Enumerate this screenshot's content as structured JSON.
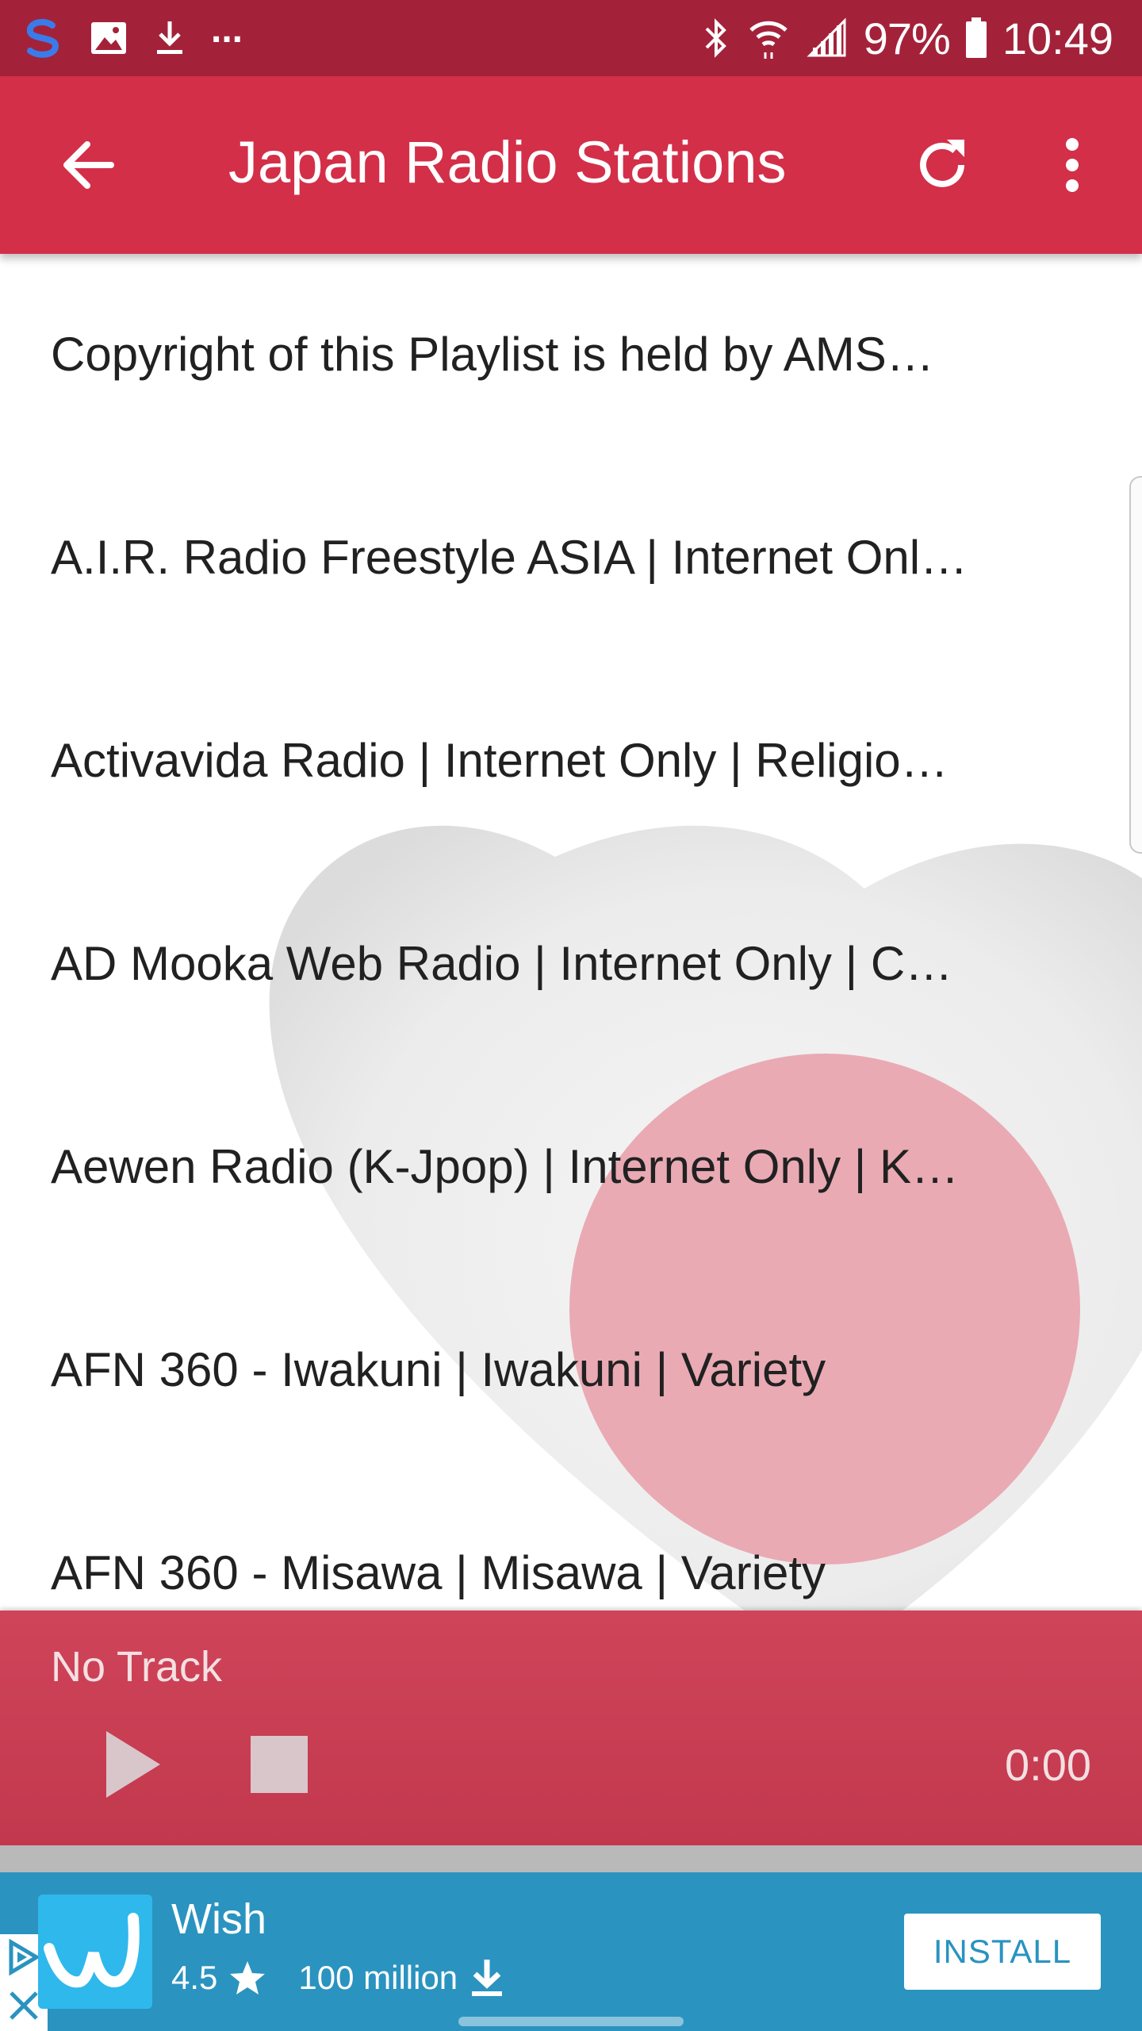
{
  "status_bar": {
    "battery": "97%",
    "time": "10:49",
    "more_indicator": "..."
  },
  "toolbar": {
    "title": "Japan Radio Stations",
    "back_icon": "arrow-left-icon",
    "refresh_icon": "refresh-icon",
    "more_icon": "more-vert-icon"
  },
  "stations": [
    "Copyright of this Playlist is held by AMS…",
    "A.I.R. Radio Freestyle ASIA | Internet Onl…",
    "Activavida Radio | Internet Only | Religio…",
    "AD Mooka Web Radio | Internet Only | C…",
    "Aewen Radio (K-Jpop) | Internet Only | K…",
    "AFN 360 - Iwakuni | Iwakuni | Variety",
    "AFN 360 - Misawa | Misawa | Variety"
  ],
  "player": {
    "track": "No Track",
    "time": "0:00"
  },
  "ad": {
    "app_name": "Wish",
    "rating": "4.5",
    "downloads": "100 million",
    "install_label": "INSTALL"
  },
  "colors": {
    "status_bar": "#a3223a",
    "toolbar": "#d32f49",
    "player": "#c93e53",
    "ad": "#2a93c0"
  }
}
